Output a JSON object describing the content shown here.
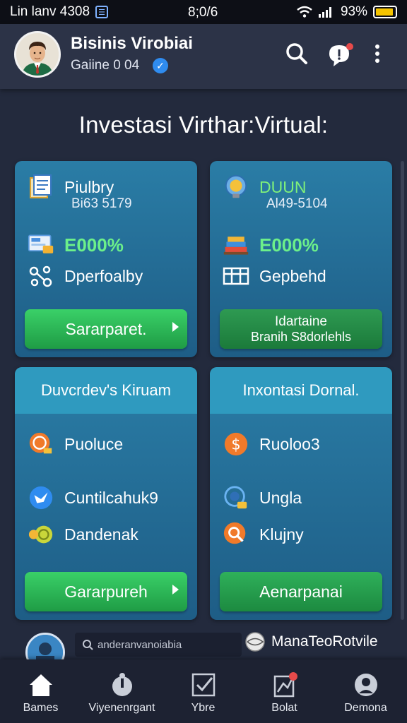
{
  "status_bar": {
    "carrier": "Lin lanv 4308",
    "time": "8;0/6",
    "battery": "93%",
    "battery_level": 0.85
  },
  "header": {
    "account_name": "Bisinis Virobiai",
    "account_id": "Gaiine 0 04"
  },
  "page_title": "Investasi Virthar:Virtual:",
  "cards": [
    {
      "title": "Piulbry",
      "code": "Bi63 5179",
      "pct": "E000%",
      "stat": "Dperfoalby",
      "button": "Sararparet."
    },
    {
      "title": "DUUN",
      "code": "Al49-5104",
      "pct": "E000%",
      "stat": "Gepbehd",
      "button_line1": "Idartaine",
      "button_line2": "Branih S8dorlehls"
    },
    {
      "header": "Duvcrdev's Kiruam",
      "items": [
        "Puoluce",
        "Cuntilcahuk9",
        "Dandenak"
      ],
      "button": "Gararpureh"
    },
    {
      "header": "Inxontasi Dornal.",
      "items": [
        "Ruoloo3",
        "Ungla",
        "Klujny"
      ],
      "button": "Aenarpanai"
    }
  ],
  "strip": {
    "search_text": "anderanvanoiabia",
    "link": "ManaTeoRotvile"
  },
  "nav": [
    "Bames",
    "Viyenenrgant",
    "Ybre",
    "Bolat",
    "Demona"
  ],
  "colors": {
    "accent_green": "#2dbb58",
    "card_blue": "#2a7da6",
    "verified_blue": "#2f8cf0",
    "notification_red": "#e74a4a"
  },
  "icons": [
    "search-icon",
    "chat-icon",
    "more-icon",
    "home-icon",
    "wallet-icon",
    "checkbox-icon",
    "bell-icon",
    "profile-icon"
  ]
}
